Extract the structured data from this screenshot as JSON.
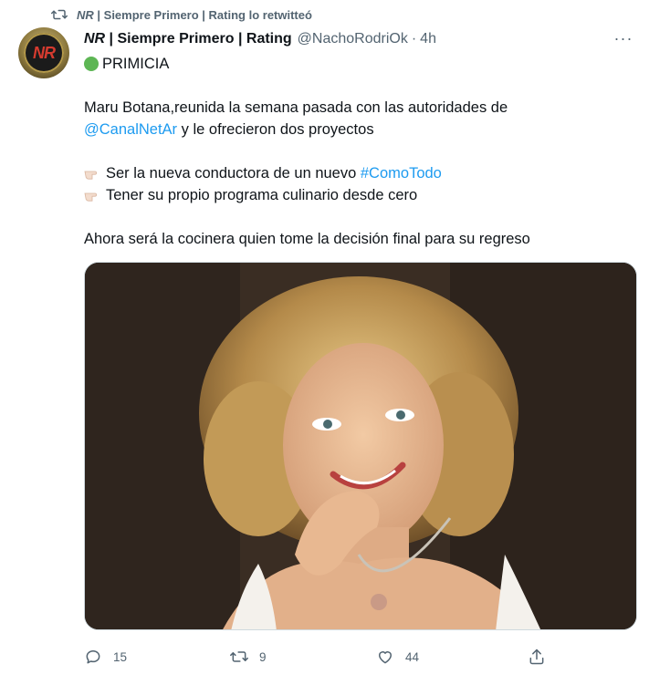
{
  "retweet_banner": {
    "account_em": "NR",
    "account_rest": " | Siempre Primero | Rating lo retwitteó"
  },
  "tweet": {
    "author_em": "NR",
    "author_rest": " | Siempre Primero | Rating",
    "handle": "@NachoRodriOk",
    "separator": "·",
    "time": "4h",
    "more": "···",
    "lines": {
      "l1": "PRIMICIA",
      "l2": "Maru Botana,reunida la semana pasada con las autoridades de",
      "l3_link": "@CanalNetAr",
      "l3_rest": " y le ofrecieron dos proyectos",
      "l4_text": "Ser la nueva conductora de un nuevo ",
      "l4_link": "#ComoTodo",
      "l5": "Tener su propio programa culinario desde cero",
      "l6": "Ahora será la cocinera quien tome la decisión final para su regreso"
    }
  },
  "avatar": {
    "logo": "NR"
  },
  "actions": {
    "reply_count": "15",
    "retweet_count": "9",
    "like_count": "44"
  },
  "icons": {
    "retweet": "retweet-icon",
    "reply": "reply-icon",
    "like": "heart-icon",
    "share": "share-icon",
    "more": "more-icon"
  },
  "colors": {
    "link": "#1d9bf0",
    "muted": "#536471",
    "text": "#0f1419"
  }
}
